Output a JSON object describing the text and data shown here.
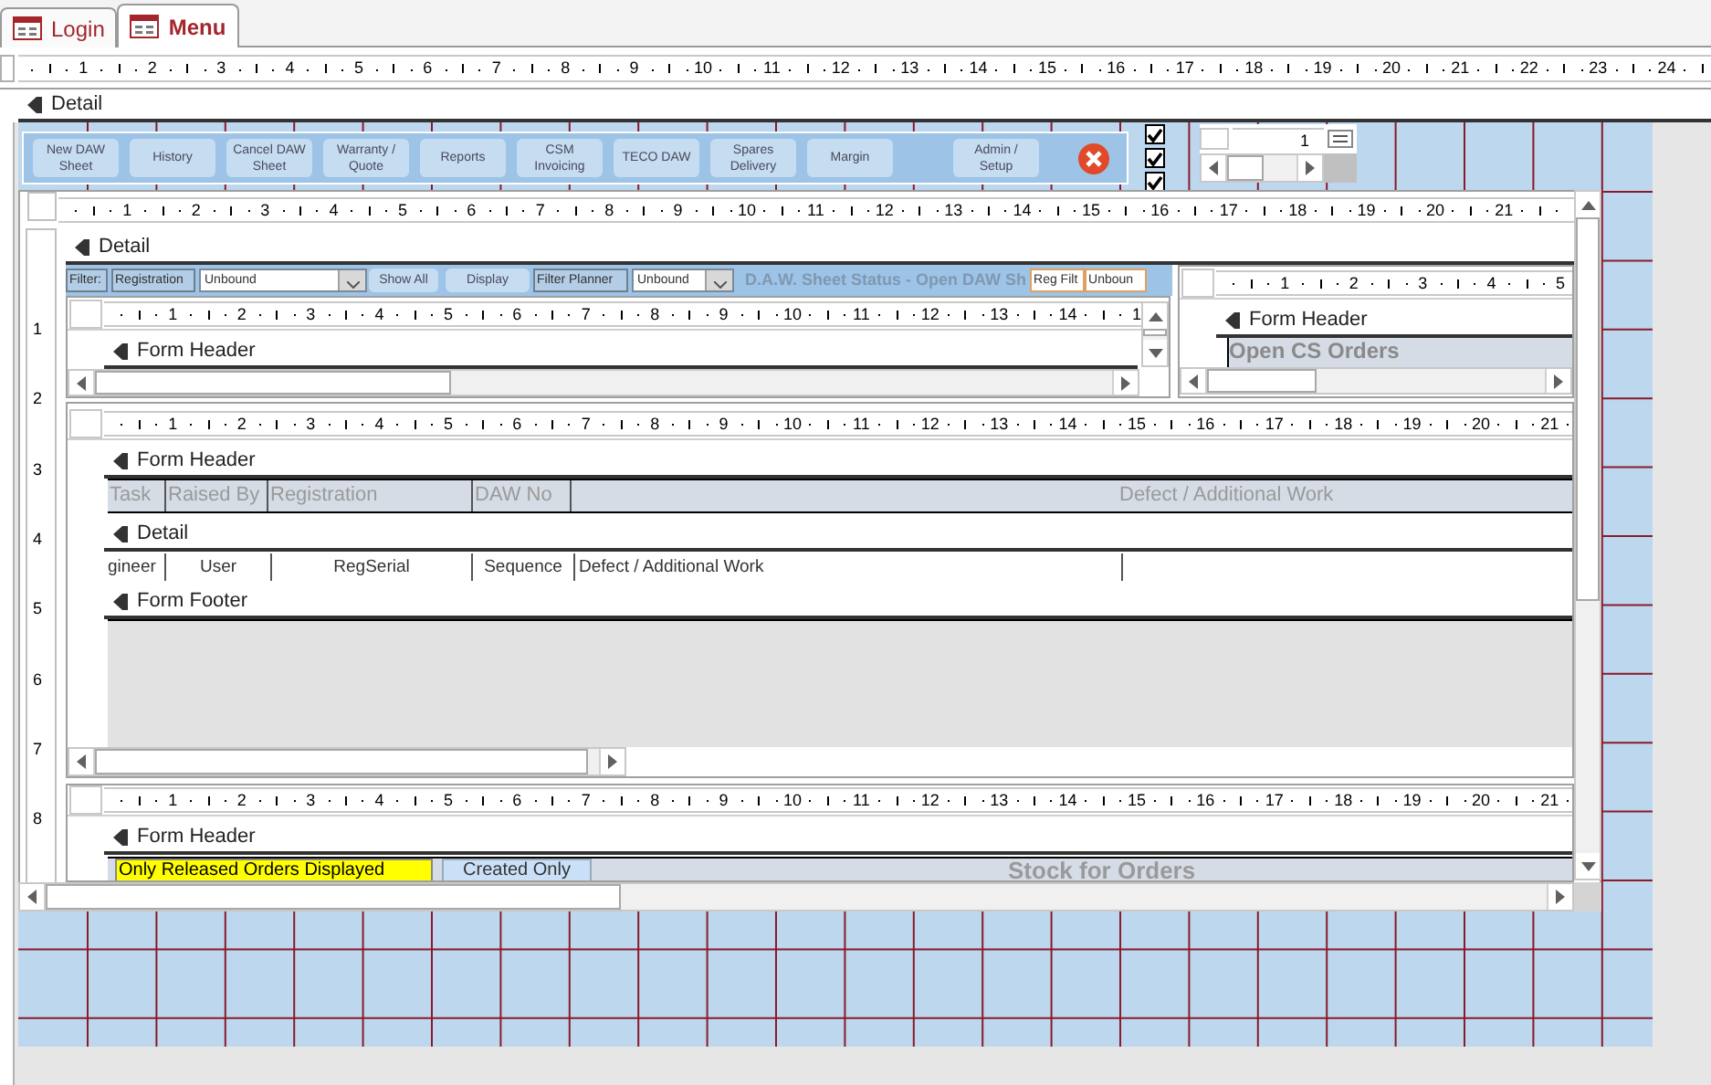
{
  "tabs": [
    {
      "label": "Login",
      "selected": false
    },
    {
      "label": "Menu",
      "selected": true
    }
  ],
  "main_ruler": [
    "1",
    "2",
    "3",
    "4",
    "5",
    "6",
    "7",
    "8",
    "9",
    "10",
    "11",
    "12",
    "13",
    "14",
    "15",
    "16",
    "17",
    "18",
    "19",
    "20",
    "21",
    "22",
    "23",
    "24"
  ],
  "main_section": "Detail",
  "menu_buttons": [
    {
      "label": "New DAW\nSheet"
    },
    {
      "label": "History"
    },
    {
      "label": "Cancel DAW\nSheet"
    },
    {
      "label": "Warranty /\nQuote"
    },
    {
      "label": "Reports"
    },
    {
      "label": "CSM\nInvoicing"
    },
    {
      "label": "TECO DAW"
    },
    {
      "label": "Spares\nDelivery"
    },
    {
      "label": "Margin"
    },
    {
      "label": "Admin /\nSetup"
    }
  ],
  "checkboxes": [
    {
      "checked": true
    },
    {
      "checked": true
    },
    {
      "checked": true
    }
  ],
  "small_subform": {
    "ruler": [
      "1"
    ]
  },
  "subform": {
    "ruler": [
      "1",
      "2",
      "3",
      "4",
      "5",
      "6",
      "7",
      "8",
      "9",
      "10",
      "11",
      "12",
      "13",
      "14",
      "15",
      "16",
      "17",
      "18",
      "19",
      "20",
      "21"
    ],
    "vertical_ruler": [
      "1",
      "2",
      "3",
      "4",
      "5",
      "6",
      "7",
      "8"
    ],
    "section": "Detail",
    "toolbar": [
      {
        "kind": "label",
        "text": "Filter:"
      },
      {
        "kind": "label",
        "text": "Registration"
      },
      {
        "kind": "combo",
        "text": "Unbound"
      },
      {
        "kind": "button",
        "text": "Show All"
      },
      {
        "kind": "button",
        "text": "Display"
      },
      {
        "kind": "label",
        "text": "Filter Planner"
      },
      {
        "kind": "combo",
        "text": "Unbound"
      },
      {
        "kind": "title",
        "text": "D.A.W. Sheet Status - Open DAW Sh"
      },
      {
        "kind": "field",
        "text": "Reg Filt"
      },
      {
        "kind": "field",
        "text": "Unboun"
      }
    ]
  },
  "filter_subform": {
    "ruler": [
      "1",
      "2",
      "3",
      "4",
      "5",
      "6",
      "7",
      "8",
      "9",
      "10",
      "11",
      "12",
      "13",
      "14",
      "1"
    ],
    "section": "Form Header"
  },
  "orders_subform": {
    "ruler": [
      "1",
      "2",
      "3",
      "4",
      "5"
    ],
    "section": "Form Header",
    "title": "Open CS Orders"
  },
  "tasks_subform": {
    "ruler": [
      "1",
      "2",
      "3",
      "4",
      "5",
      "6",
      "7",
      "8",
      "9",
      "10",
      "11",
      "12",
      "13",
      "14",
      "15",
      "16",
      "17",
      "18",
      "19",
      "20",
      "21"
    ],
    "header": "Form Header",
    "columns": [
      "Task",
      "Raised By",
      "Registration",
      "DAW No",
      "Defect / Additional Work"
    ],
    "detail": "Detail",
    "fields": [
      "gineer",
      "User",
      "RegSerial",
      "Sequence",
      "Defect / Additional Work"
    ],
    "footer": "Form Footer"
  },
  "stock_subform": {
    "ruler": [
      "1",
      "2",
      "3",
      "4",
      "5",
      "6",
      "7",
      "8",
      "9",
      "10",
      "11",
      "12",
      "13",
      "14",
      "15",
      "16",
      "17",
      "18",
      "19",
      "20",
      "21"
    ],
    "header": "Form Header",
    "notice": "Only Released Orders Displayed",
    "button": "Created Only",
    "title": "Stock for Orders"
  }
}
